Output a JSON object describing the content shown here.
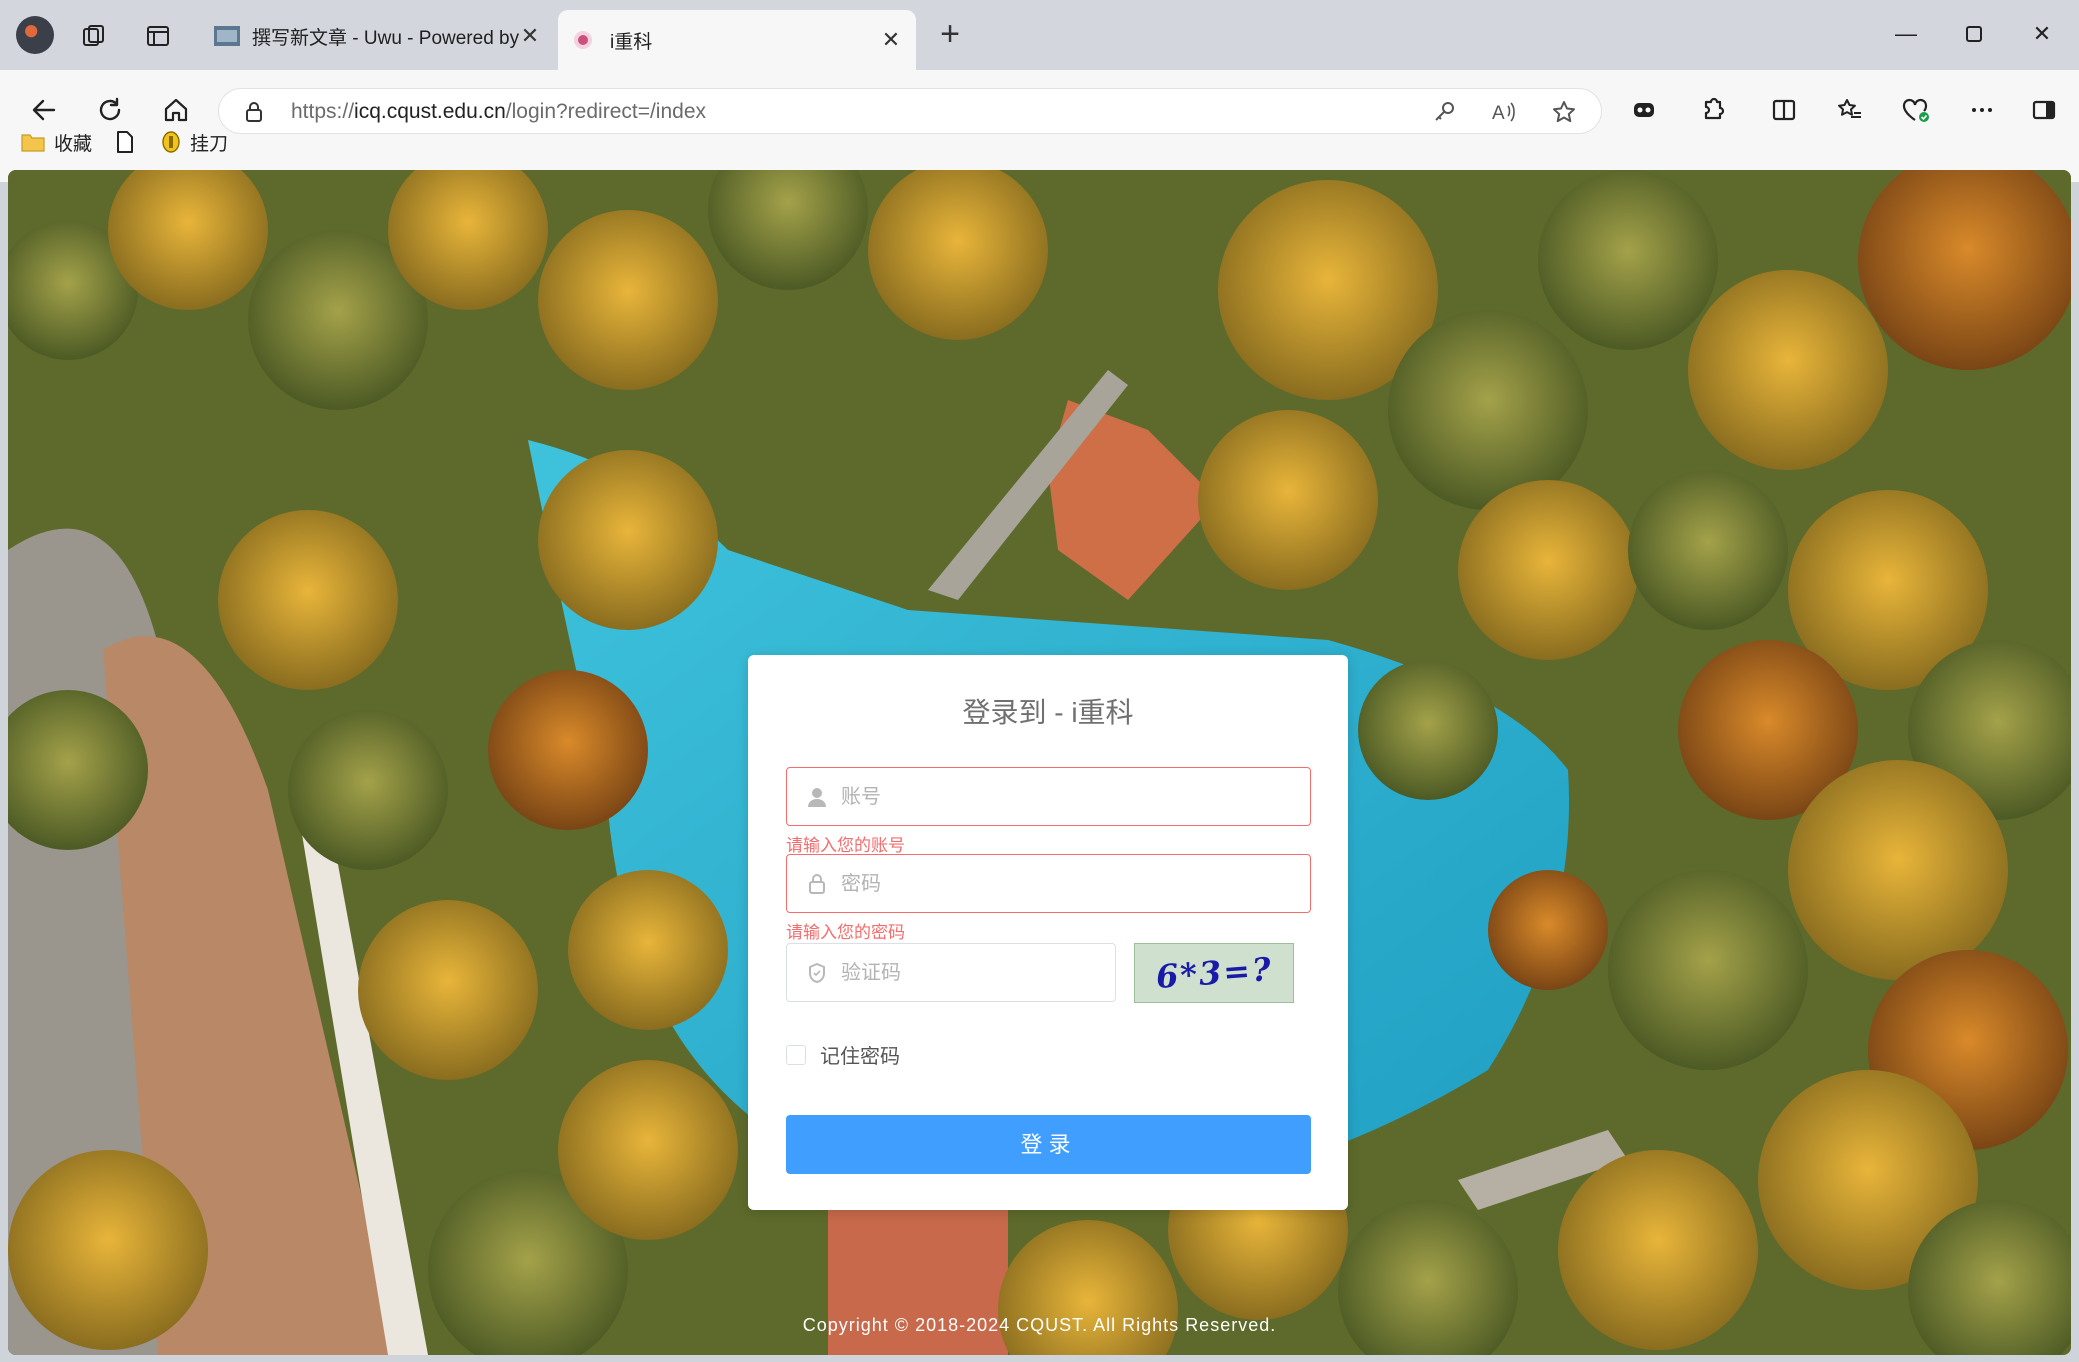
{
  "browser": {
    "tabs": [
      {
        "title": "撰写新文章 - Uwu - Powered by Typecho",
        "active": false
      },
      {
        "title": "i重科",
        "active": true
      }
    ],
    "address": {
      "host": "icq.cqust.edu.cn",
      "path": "/login?redirect=/index",
      "scheme": "https://"
    },
    "bookmarks": [
      {
        "label": "收藏",
        "icon": "folder-icon"
      },
      {
        "label": "",
        "icon": "page-icon"
      },
      {
        "label": "挂刀",
        "icon": "coin-icon"
      }
    ]
  },
  "login": {
    "title": "登录到 - i重科",
    "username": {
      "value": "",
      "placeholder": "账号",
      "error": "请输入您的账号"
    },
    "password": {
      "value": "",
      "placeholder": "密码",
      "error": "请输入您的密码"
    },
    "captcha": {
      "value": "",
      "placeholder": "验证码",
      "image_text": "6*3=?"
    },
    "remember_label": "记住密码",
    "submit_label": "登录"
  },
  "footer": {
    "copyright": "Copyright © 2018-2024 CQUST. All Rights Reserved."
  },
  "colors": {
    "accent": "#409eff",
    "error": "#f56c6c"
  }
}
